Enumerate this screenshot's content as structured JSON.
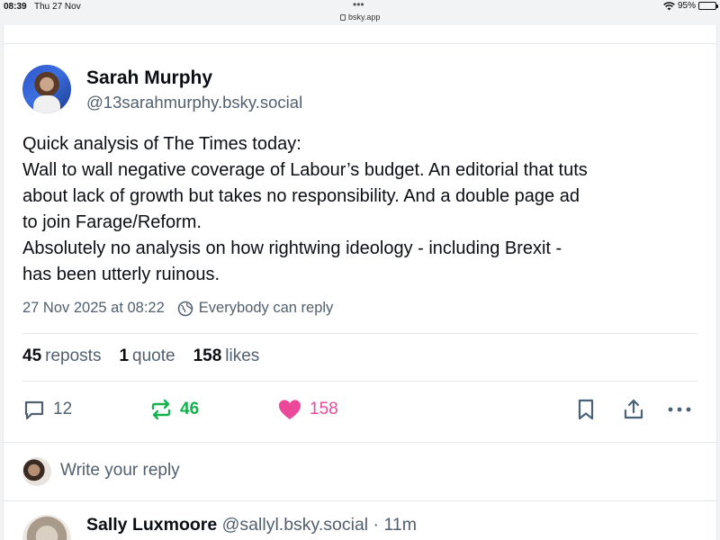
{
  "status_bar": {
    "time": "08:39",
    "date": "Thu 27 Nov",
    "url": "bsky.app",
    "battery": "95%",
    "battery_level": 0.95
  },
  "post": {
    "author": {
      "display_name": "Sarah Murphy",
      "handle": "@13sarahmurphy.bsky.social"
    },
    "text_lines": [
      "Quick analysis of The Times today:",
      "Wall to wall negative coverage of Labour’s budget. An editorial that tuts",
      "about lack of growth but takes no responsibility. And a double page ad",
      "to join Farage/Reform.",
      "Absolutely no analysis on how rightwing ideology - including Brexit -",
      "has been utterly ruinous."
    ],
    "timestamp": "27 Nov 2025 at 08:22",
    "reply_setting": "Everybody can reply",
    "stats": {
      "reposts_count": "45",
      "reposts_label": "reposts",
      "quotes_count": "1",
      "quotes_label": "quote",
      "likes_count": "158",
      "likes_label": "likes"
    },
    "actions": {
      "reply_count": "12",
      "repost_count": "46",
      "like_count": "158"
    }
  },
  "reply_box": {
    "placeholder": "Write your reply"
  },
  "next_post": {
    "display_name": "Sally Luxmoore",
    "handle": "@sallyl.bsky.social",
    "separator": "·",
    "age": "11m"
  },
  "colors": {
    "text_primary": "#0b0f14",
    "text_secondary": "#52606d",
    "repost_green": "#13b24a",
    "like_pink": "#ec4899",
    "icon_blue_gray": "#4a6278",
    "divider": "#e3e6ea"
  }
}
